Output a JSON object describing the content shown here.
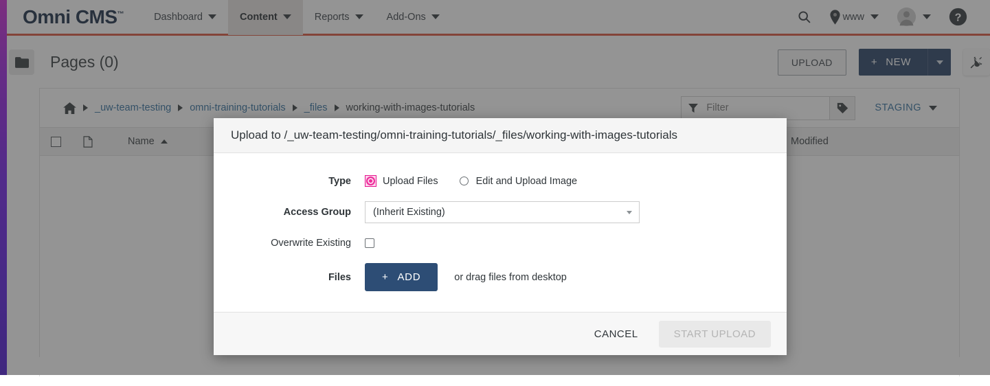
{
  "brand": {
    "name": "Omni CMS",
    "tm": "™"
  },
  "topnav": {
    "items": [
      {
        "label": "Dashboard",
        "icon": "chevron-down-icon",
        "active": false
      },
      {
        "label": "Content",
        "icon": "chevron-down-icon",
        "active": true
      },
      {
        "label": "Reports",
        "icon": "chevron-down-icon",
        "active": false
      },
      {
        "label": "Add-Ons",
        "icon": "chevron-down-icon",
        "active": false
      }
    ],
    "search_icon": "search-icon",
    "site_pin_icon": "location-pin-icon",
    "site_label": "www",
    "avatar_icon": "avatar-icon",
    "help_icon": "help-circle-icon"
  },
  "pageheader": {
    "folder_icon": "folder-icon",
    "title": "Pages (0)",
    "upload_label": "UPLOAD",
    "new_label": "NEW",
    "new_plus": "+",
    "new_dropdown_icon": "chevron-down-icon",
    "plug_icon": "plug-icon"
  },
  "breadcrumb": {
    "home_icon": "home-icon",
    "items": [
      {
        "label": "_uw-team-testing",
        "current": false
      },
      {
        "label": "omni-training-tutorials",
        "current": false
      },
      {
        "label": "_files",
        "current": false
      },
      {
        "label": "working-with-images-tutorials",
        "current": true
      }
    ]
  },
  "toolbar": {
    "filter_icon": "filter-icon",
    "filter_placeholder": "Filter",
    "filter_value": "",
    "tag_icon": "tag-icon",
    "staging_label": "STAGING",
    "staging_caret_icon": "chevron-down-icon"
  },
  "table": {
    "select_all_icon": "checkbox-icon",
    "file_type_icon": "file-icon",
    "columns": [
      {
        "label": "Name",
        "sort": "asc",
        "sort_icon": "sort-ascending-icon"
      },
      {
        "label": "Modified",
        "sort": null
      }
    ],
    "rows": []
  },
  "dialog": {
    "title": "Upload to /_uw-team-testing/omni-training-tutorials/_files/working-with-images-tutorials",
    "type": {
      "label": "Type",
      "options": [
        {
          "label": "Upload Files",
          "selected": true
        },
        {
          "label": "Edit and Upload Image",
          "selected": false
        }
      ]
    },
    "access_group": {
      "label": "Access Group",
      "value": "(Inherit Existing)",
      "caret_icon": "chevron-down-icon"
    },
    "overwrite": {
      "label": "Overwrite Existing",
      "checked": false
    },
    "files": {
      "label": "Files",
      "add_label": "ADD",
      "add_plus": "+",
      "hint": "or drag files from desktop"
    },
    "footer": {
      "cancel_label": "CANCEL",
      "start_label": "START UPLOAD",
      "start_disabled": true
    }
  },
  "colors": {
    "brand_navy": "#10243e",
    "accent_orange": "#d94f35",
    "link_blue": "#2b6a9b",
    "button_navy": "#1f3a5f",
    "radio_pink": "#ef2a9a",
    "rail_top": "#c81fd0",
    "rail_bottom": "#4511cf"
  }
}
